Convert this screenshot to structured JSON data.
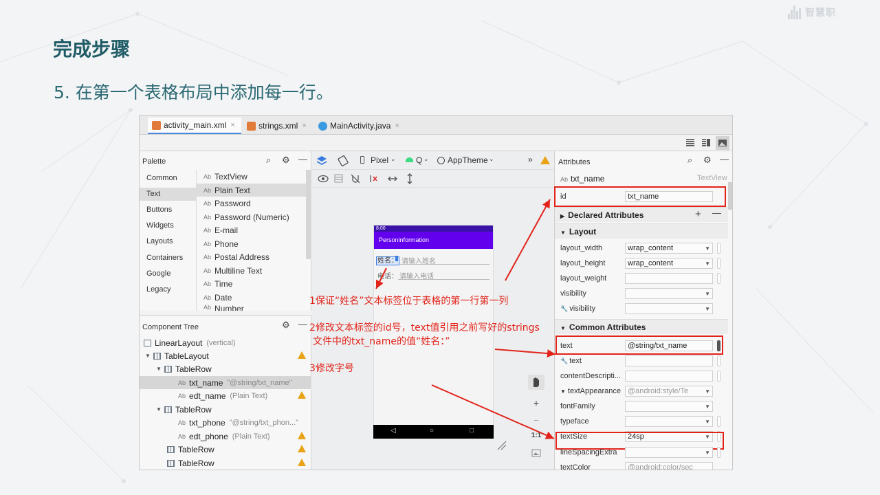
{
  "slide": {
    "title": "完成步骤",
    "subtitle": "5. 在第一个表格布局中添加每一行。",
    "logo_text": "智慧职"
  },
  "ide": {
    "tabs": [
      {
        "label": "activity_main.xml",
        "close": "×"
      },
      {
        "label": "strings.xml",
        "close": "×"
      },
      {
        "label": "MainActivity.java",
        "close": "×"
      }
    ],
    "palette": {
      "title": "Palette",
      "categories": [
        "Common",
        "Text",
        "Buttons",
        "Widgets",
        "Layouts",
        "Containers",
        "Google",
        "Legacy"
      ],
      "selected_category": "Text",
      "items": [
        "TextView",
        "Plain Text",
        "Password",
        "Password (Numeric)",
        "E-mail",
        "Phone",
        "Postal Address",
        "Multiline Text",
        "Time",
        "Date",
        "Number"
      ],
      "item_prefix": "Ab"
    },
    "component_tree": {
      "title": "Component Tree",
      "rows": [
        {
          "label": "LinearLayout",
          "sub": "(vertical)"
        },
        {
          "label": "TableLayout",
          "sub": ""
        },
        {
          "label": "TableRow",
          "sub": ""
        },
        {
          "label": "txt_name",
          "sub": "\"@string/txt_name\""
        },
        {
          "label": "edt_name",
          "sub": "(Plain Text)"
        },
        {
          "label": "TableRow",
          "sub": ""
        },
        {
          "label": "txt_phone",
          "sub": "\"@string/txt_phon...\""
        },
        {
          "label": "edt_phone",
          "sub": "(Plain Text)"
        },
        {
          "label": "TableRow",
          "sub": ""
        },
        {
          "label": "TableRow",
          "sub": ""
        }
      ]
    },
    "design_toolbar": {
      "device": "Pixel",
      "api": "Q",
      "theme": "AppTheme",
      "overflow": "»"
    },
    "preview": {
      "status_time": "8:00",
      "app_title": "Personinformation",
      "name_label": "姓名：",
      "name_hint": "请输入姓名",
      "phone_label": "电话：",
      "phone_hint": "请输入电话",
      "nav_back": "◁",
      "nav_home": "○",
      "nav_recent": "□"
    },
    "zoom": {
      "plus": "+",
      "minus": "−",
      "one_to_one": "1:1"
    },
    "attributes": {
      "title": "Attributes",
      "component_type_prefix": "Ab",
      "component_name": "txt_name",
      "component_kind": "TextView",
      "id_key": "id",
      "id_value": "txt_name",
      "declared": "Declared Attributes",
      "layout_section": "Layout",
      "layout_rows": [
        {
          "key": "layout_width",
          "value": "wrap_content"
        },
        {
          "key": "layout_height",
          "value": "wrap_content"
        },
        {
          "key": "layout_weight",
          "value": ""
        },
        {
          "key": "visibility",
          "value": ""
        },
        {
          "key": "visibility",
          "value": ""
        }
      ],
      "common_section": "Common Attributes",
      "common_rows": [
        {
          "key": "text",
          "value": "@string/txt_name"
        },
        {
          "key": "text",
          "value": ""
        },
        {
          "key": "contentDescripti...",
          "value": ""
        },
        {
          "key": "textAppearance",
          "value": "@android:style/Te"
        },
        {
          "key": "fontFamily",
          "value": ""
        },
        {
          "key": "typeface",
          "value": ""
        },
        {
          "key": "textSize",
          "value": "24sp"
        },
        {
          "key": "lineSpacingExtra",
          "value": ""
        },
        {
          "key": "textColor",
          "value": "@android:color/sec"
        }
      ]
    }
  },
  "annotations": {
    "a1": "1保证“姓名”文本标签位于表格的第一行第一列",
    "a2_line1": "2修改文本标签的id号，text值引用之前写好的strings",
    "a2_line2": "文件中的txt_name的值“姓名：”",
    "a3": "3修改字号"
  },
  "colors": {
    "title": "#1f5c66",
    "annotation": "#e2231a",
    "app_bar": "#6200ee",
    "warning": "#e8a317"
  }
}
